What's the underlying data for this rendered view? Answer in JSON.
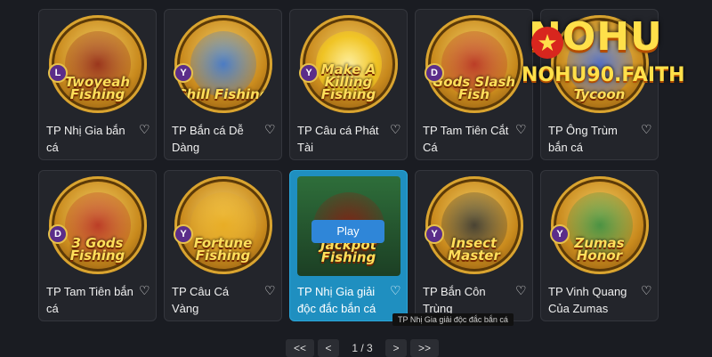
{
  "games": [
    {
      "title": "TP Nhị Gia bắn cá",
      "logo": "Twoyeah Fishing",
      "badge": "L",
      "accent": "#8c1d12"
    },
    {
      "title": "TP Bắn cá Dễ Dàng",
      "logo": "Chill Fishing",
      "badge": "Y",
      "accent": "#2f6fd6"
    },
    {
      "title": "TP Câu cá Phát Tài",
      "logo": "Make A Killing Fishing",
      "badge": "Y",
      "accent": "#f3c820"
    },
    {
      "title": "TP Tam Tiên Cắt Cá",
      "logo": "Gods Slash Fish",
      "badge": "D",
      "accent": "#b3261e"
    },
    {
      "title": "TP Ông Trùm bắn cá",
      "logo": "Tycoon",
      "badge": "",
      "accent": "#3a5fd1"
    },
    {
      "title": "TP Tam Tiên bắn cá",
      "logo": "3 Gods Fishing",
      "badge": "D",
      "accent": "#b3261e"
    },
    {
      "title": "TP Câu Cá Vàng",
      "logo": "Fortune Fishing",
      "badge": "Y",
      "accent": "#e7a91c"
    },
    {
      "title": "TP Nhị Gia giải độc đắc bắn cá",
      "logo": "Twoyeah Jackpot Fishing",
      "badge": "",
      "accent": "#1f7c3a"
    },
    {
      "title": "TP Bắn Côn Trùng",
      "logo": "Insect Master",
      "badge": "Y",
      "accent": "#2c2c2c"
    },
    {
      "title": "TP Vinh Quang Của Zumas",
      "logo": "Zumas Honor",
      "badge": "Y",
      "accent": "#2e8a3f"
    }
  ],
  "play_label": "Play",
  "tooltip": "TP Nhị Gia giải độc đắc bắn cá",
  "pager": {
    "first": "<<",
    "prev": "<",
    "page": "1 / 3",
    "next": ">",
    "last": ">>"
  },
  "brand": {
    "word": "NOHU",
    "star": "★",
    "site": "NOHU90.FAITH"
  },
  "colors": {
    "card": "#23252b",
    "active": "#1f8fc0",
    "gold": "#ffe04a"
  }
}
